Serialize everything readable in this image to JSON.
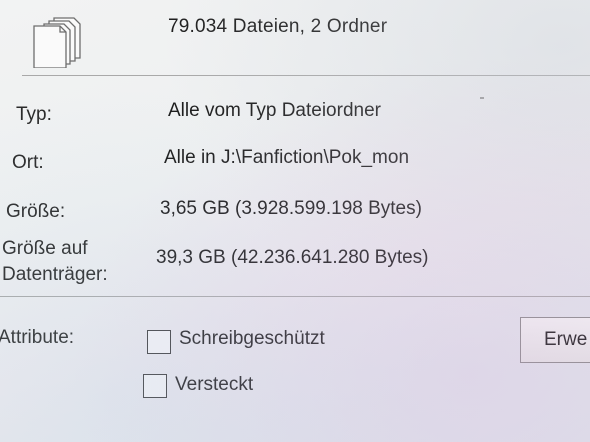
{
  "header": {
    "file_count_text": "79.034 Dateien, 2 Ordner",
    "icon": "multiple-files-icon"
  },
  "properties": {
    "type_label": "Typ:",
    "type_value": "Alle vom Typ Dateiordner",
    "location_label": "Ort:",
    "location_value": "Alle in J:\\Fanfiction\\Pok_mon",
    "size_label": "Größe:",
    "size_value": "3,65 GB (3.928.599.198 Bytes)",
    "size_on_disk_label_line1": "Größe auf",
    "size_on_disk_label_line2": "Datenträger:",
    "size_on_disk_value": "39,3 GB (42.236.641.280 Bytes)"
  },
  "attributes": {
    "label": "Attribute:",
    "read_only_label": "Schreibgeschützt",
    "read_only_checked": false,
    "hidden_label": "Versteckt",
    "hidden_checked": false,
    "advanced_button_label": "Erwe"
  }
}
